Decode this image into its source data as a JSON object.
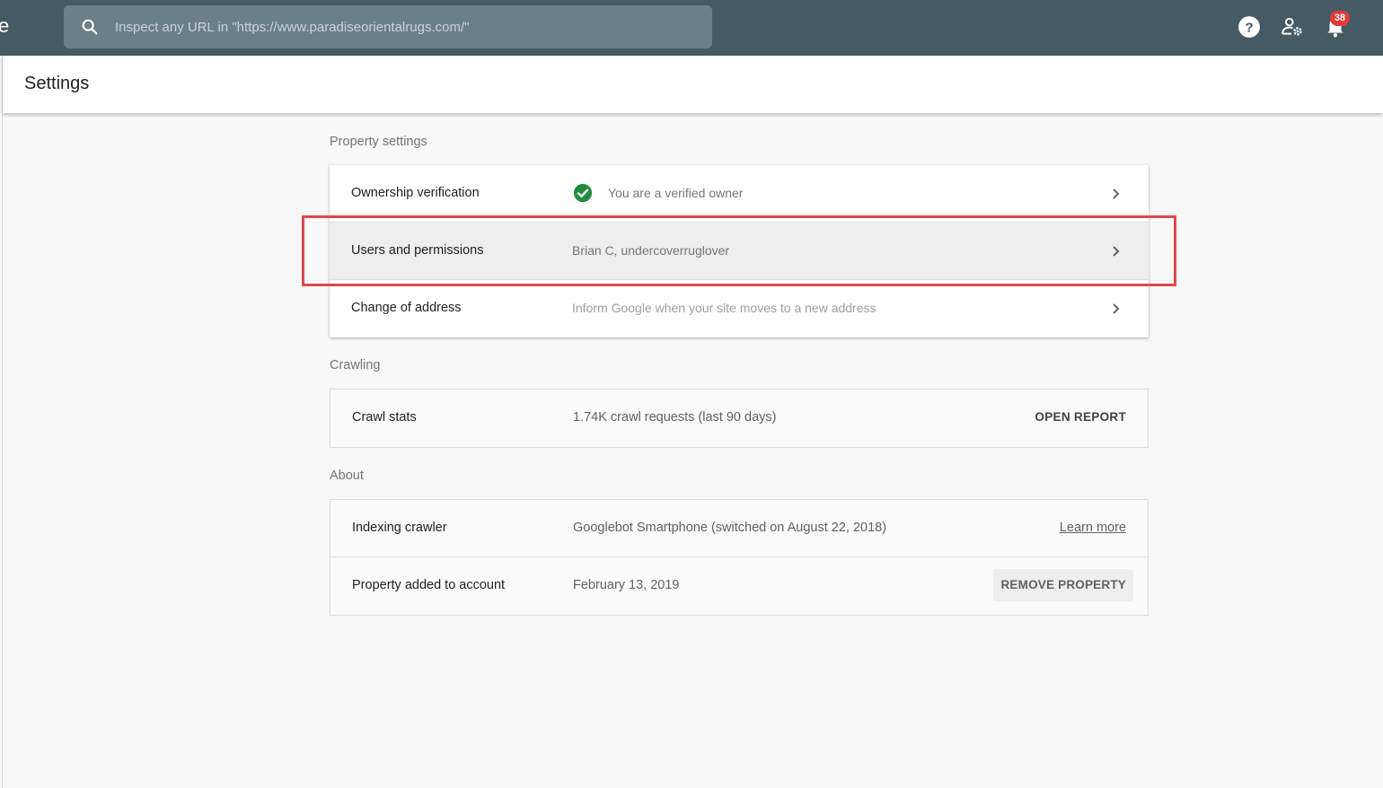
{
  "topbar": {
    "edge_letter": "e",
    "search_placeholder": "Inspect any URL in \"https://www.paradiseorientalrugs.com/\"",
    "search_icon": "search-icon",
    "icons": [
      "help-icon",
      "admin-settings-icon",
      "notifications-bell-icon"
    ],
    "notification_count": "38",
    "badge_color": "#e53935",
    "bar_color": "#455a64"
  },
  "header": {
    "title": "Settings"
  },
  "sections": {
    "property_settings": {
      "label": "Property settings",
      "rows": [
        {
          "label": "Ownership verification",
          "value": "You are a verified owner",
          "icon": "check-circle-icon",
          "icon_color": "#1e8e3e"
        },
        {
          "label": "Users and permissions",
          "value": "Brian C, undercoverruglover"
        },
        {
          "label": "Change of address",
          "value": "Inform Google when your site moves to a new address"
        }
      ]
    },
    "crawling": {
      "label": "Crawling",
      "rows": [
        {
          "label": "Crawl stats",
          "value": "1.74K crawl requests (last 90 days)",
          "action": "OPEN REPORT"
        }
      ]
    },
    "about": {
      "label": "About",
      "rows": [
        {
          "label": "Indexing crawler",
          "value": "Googlebot Smartphone (switched on August 22, 2018)",
          "action": "Learn more"
        },
        {
          "label": "Property added to account",
          "value": "February 13, 2019",
          "action": "REMOVE PROPERTY"
        }
      ]
    }
  },
  "annotation": {
    "color": "#e0494a",
    "target": "Users and permissions"
  }
}
